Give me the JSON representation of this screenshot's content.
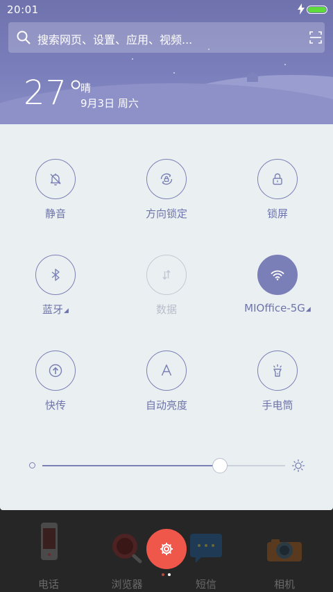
{
  "status_bar": {
    "time": "20:01",
    "battery_icon": "battery-full-icon",
    "charging_icon": "charging-bolt-icon"
  },
  "search": {
    "placeholder": "搜索网页、设置、应用、视频...",
    "icon": "search-icon",
    "scan_icon": "scan-icon"
  },
  "weather": {
    "temperature": "27°",
    "condition": "晴",
    "date": "9月3日 周六"
  },
  "toggles": [
    {
      "label": "静音",
      "icon": "silent-bell-icon",
      "state": "off"
    },
    {
      "label": "方向锁定",
      "icon": "rotation-lock-icon",
      "state": "off"
    },
    {
      "label": "锁屏",
      "icon": "lock-icon",
      "state": "off"
    },
    {
      "label": "蓝牙",
      "icon": "bluetooth-icon",
      "state": "off",
      "expandable": true
    },
    {
      "label": "数据",
      "icon": "mobile-data-icon",
      "state": "disabled"
    },
    {
      "label": "MIOffice-5G",
      "icon": "wifi-icon",
      "state": "on",
      "expandable": true
    },
    {
      "label": "快传",
      "icon": "quick-transfer-icon",
      "state": "off"
    },
    {
      "label": "自动亮度",
      "icon": "auto-brightness-icon",
      "state": "off"
    },
    {
      "label": "手电筒",
      "icon": "flashlight-icon",
      "state": "off"
    }
  ],
  "brightness": {
    "level": 0.73,
    "low_icon": "brightness-low-icon",
    "high_icon": "sun-icon"
  },
  "colors": {
    "accent": "#7a7fb5",
    "panel_bg": "#eaf0f1",
    "fab": "#f0574b",
    "header": "#6f72ad"
  },
  "dock": {
    "apps": [
      {
        "label": "电话",
        "icon": "phone-app-icon"
      },
      {
        "label": "浏览器",
        "icon": "browser-app-icon"
      },
      {
        "label": "短信",
        "icon": "messages-app-icon"
      },
      {
        "label": "相机",
        "icon": "camera-app-icon"
      }
    ],
    "settings_button_icon": "gear-icon",
    "page_indicator": {
      "pages": 2,
      "current": 2
    }
  }
}
